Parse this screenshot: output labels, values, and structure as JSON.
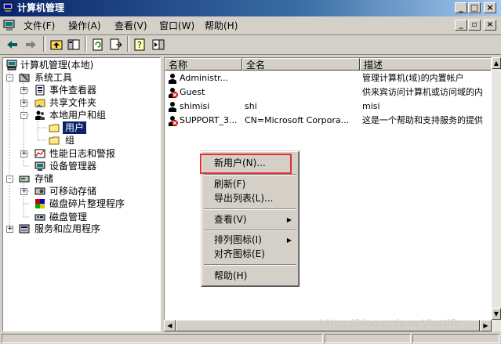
{
  "window": {
    "title": "计算机管理"
  },
  "menubar": [
    {
      "label": "文件(F)"
    },
    {
      "label": "操作(A)"
    },
    {
      "label": "查看(V)"
    },
    {
      "label": "窗口(W)"
    },
    {
      "label": "帮助(H)"
    }
  ],
  "tree": [
    {
      "label": "计算机管理(本地)",
      "icon": "computer-management-icon",
      "expander": ""
    },
    {
      "label": "系统工具",
      "icon": "system-tools-icon",
      "expander": "-"
    },
    {
      "label": "事件查看器",
      "icon": "event-viewer-icon",
      "expander": "+"
    },
    {
      "label": "共享文件夹",
      "icon": "shared-folders-icon",
      "expander": "+"
    },
    {
      "label": "本地用户和组",
      "icon": "local-users-groups-icon",
      "expander": "-"
    },
    {
      "label": "用户",
      "icon": "folder-icon",
      "expander": "",
      "selected": true
    },
    {
      "label": "组",
      "icon": "folder-icon",
      "expander": ""
    },
    {
      "label": "性能日志和警报",
      "icon": "performance-logs-icon",
      "expander": "+"
    },
    {
      "label": "设备管理器",
      "icon": "device-manager-icon",
      "expander": ""
    },
    {
      "label": "存储",
      "icon": "storage-icon",
      "expander": "-"
    },
    {
      "label": "可移动存储",
      "icon": "removable-storage-icon",
      "expander": "+"
    },
    {
      "label": "磁盘碎片整理程序",
      "icon": "disk-defrag-icon",
      "expander": ""
    },
    {
      "label": "磁盘管理",
      "icon": "disk-management-icon",
      "expander": ""
    },
    {
      "label": "服务和应用程序",
      "icon": "services-apps-icon",
      "expander": "+"
    }
  ],
  "list": {
    "columns": [
      "名称",
      "全名",
      "描述"
    ],
    "rows": [
      {
        "name": "Administr...",
        "fullname": "",
        "description": "管理计算机(域)的内置帐户",
        "disabled": false
      },
      {
        "name": "Guest",
        "fullname": "",
        "description": "供来宾访问计算机或访问域的内",
        "disabled": true
      },
      {
        "name": "shimisi",
        "fullname": "shi",
        "description": "misi",
        "disabled": false
      },
      {
        "name": "SUPPORT_3...",
        "fullname": "CN=Microsoft Corpora...",
        "description": "这是一个帮助和支持服务的提供",
        "disabled": true
      }
    ]
  },
  "context_menu": [
    {
      "label": "新用户(N)...",
      "submenu": false
    },
    {
      "separator": true
    },
    {
      "label": "刷新(F)",
      "submenu": false
    },
    {
      "label": "导出列表(L)...",
      "submenu": false
    },
    {
      "separator": true
    },
    {
      "label": "查看(V)",
      "submenu": true
    },
    {
      "separator": true
    },
    {
      "label": "排列图标(I)",
      "submenu": true
    },
    {
      "label": "对齐图标(E)",
      "submenu": false
    },
    {
      "separator": true
    },
    {
      "label": "帮助(H)",
      "submenu": false
    }
  ],
  "watermark": "https://blog.csdn.net/lustlfir",
  "colors": {
    "titlebar": "#0a246a",
    "selection": "#0a246a",
    "highlight_box": "#e03030"
  }
}
